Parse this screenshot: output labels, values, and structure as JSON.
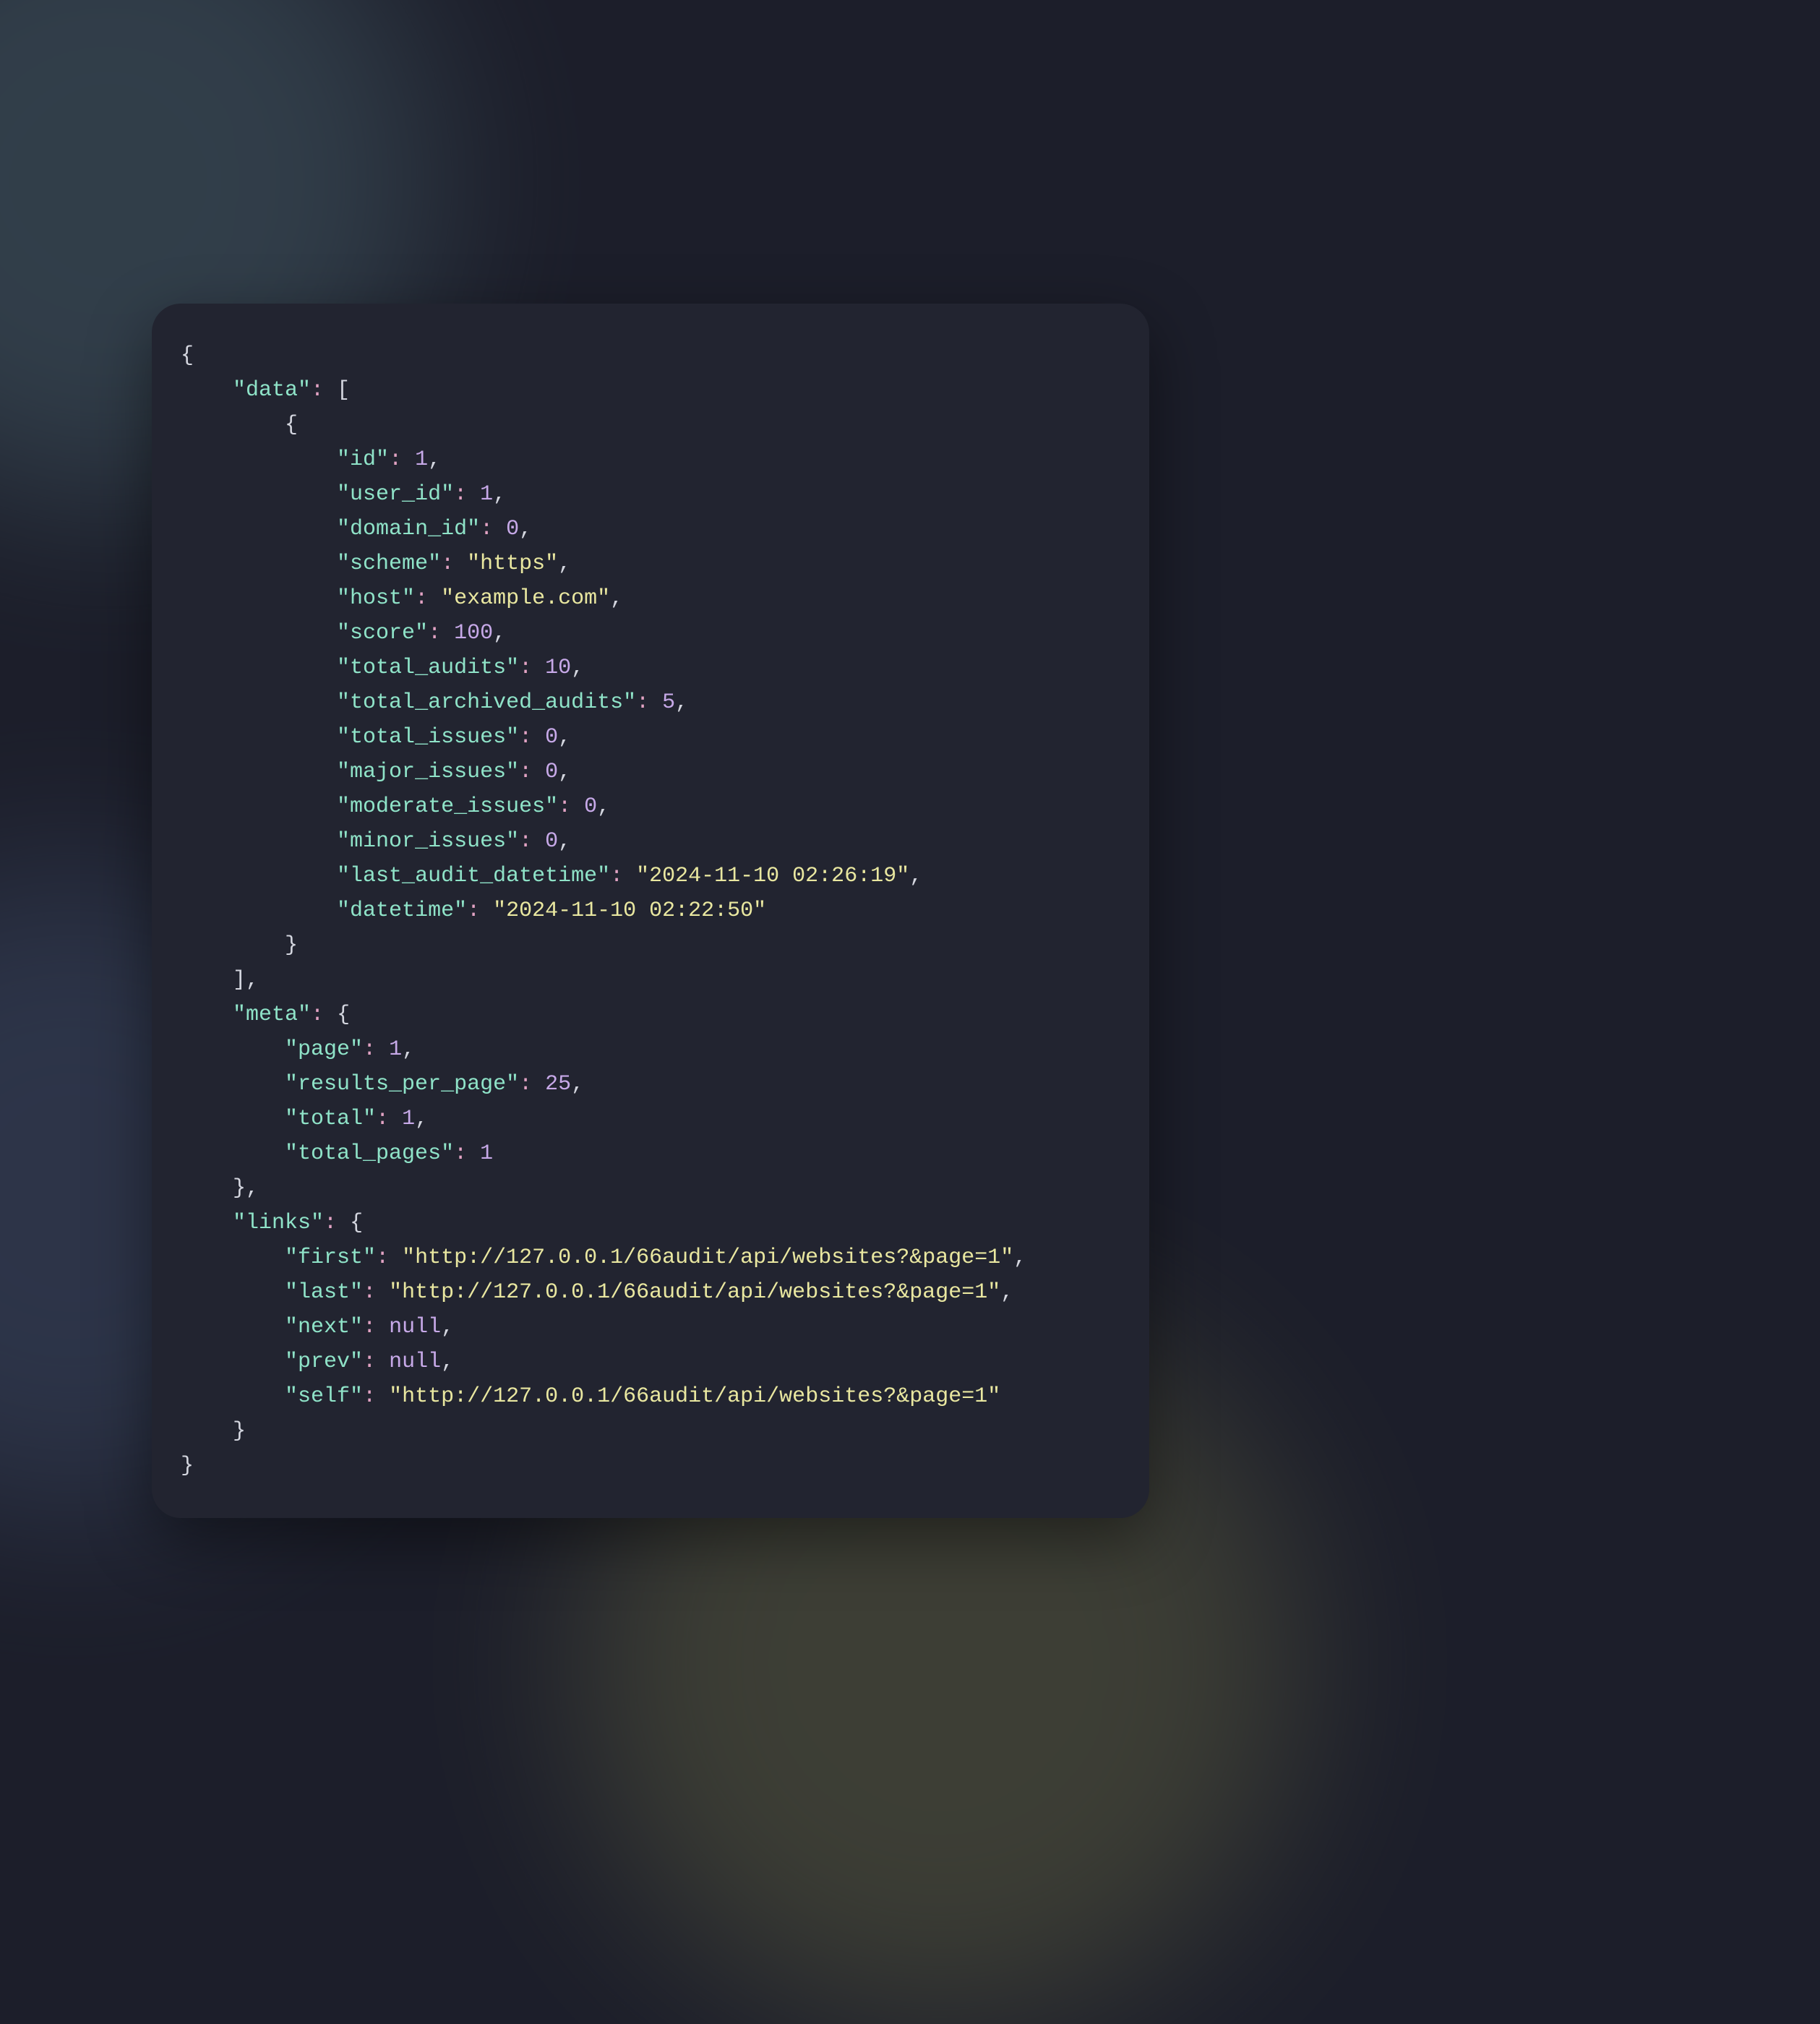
{
  "json": {
    "data": [
      {
        "id": 1,
        "user_id": 1,
        "domain_id": 0,
        "scheme": "https",
        "host": "example.com",
        "score": 100,
        "total_audits": 10,
        "total_archived_audits": 5,
        "total_issues": 0,
        "major_issues": 0,
        "moderate_issues": 0,
        "minor_issues": 0,
        "last_audit_datetime": "2024-11-10 02:26:19",
        "datetime": "2024-11-10 02:22:50"
      }
    ],
    "meta": {
      "page": 1,
      "results_per_page": 25,
      "total": 1,
      "total_pages": 1
    },
    "links": {
      "first": "http://127.0.0.1/66audit/api/websites?&page=1",
      "last": "http://127.0.0.1/66audit/api/websites?&page=1",
      "next": null,
      "prev": null,
      "self": "http://127.0.0.1/66audit/api/websites?&page=1"
    }
  },
  "indent_unit": "    "
}
